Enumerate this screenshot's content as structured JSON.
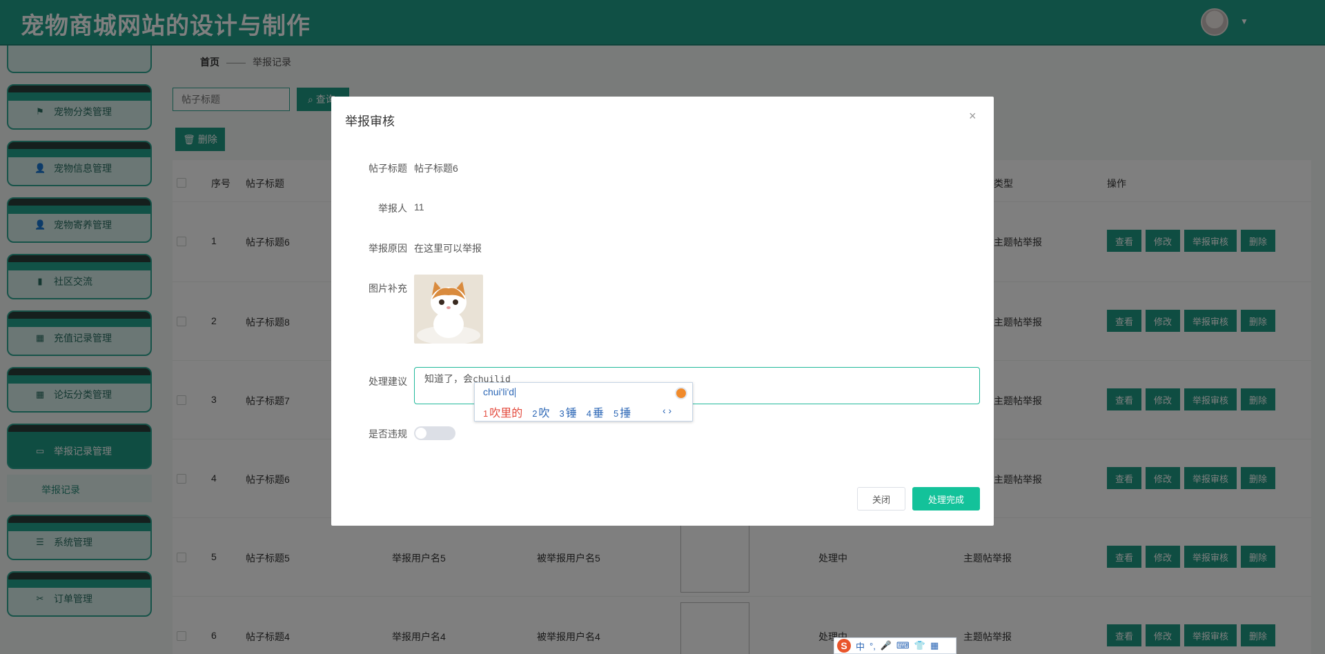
{
  "header": {
    "title": "宠物商城网站的设计与制作",
    "caret": "▼"
  },
  "sidebar": {
    "items": [
      {
        "label": "宠物分类管理",
        "icon": "⚑"
      },
      {
        "label": "宠物信息管理",
        "icon": "👤"
      },
      {
        "label": "宠物寄养管理",
        "icon": "👤"
      },
      {
        "label": "社区交流",
        "icon": "▮"
      },
      {
        "label": "充值记录管理",
        "icon": "▦"
      },
      {
        "label": "论坛分类管理",
        "icon": "▦"
      },
      {
        "label": "举报记录管理",
        "icon": "▭"
      },
      {
        "label": "系统管理",
        "icon": "☰"
      },
      {
        "label": "订单管理",
        "icon": "✂"
      }
    ],
    "submenu_label": "举报记录"
  },
  "breadcrumb": {
    "home": "首页",
    "current": "举报记录",
    "separator": "——"
  },
  "search": {
    "placeholder": "帖子标题",
    "button": "查询"
  },
  "toolbar": {
    "delete_label": "删除"
  },
  "table": {
    "headers": {
      "index": "序号",
      "title": "帖子标题",
      "type": "类型",
      "ops": "操作"
    },
    "ops": {
      "view": "查看",
      "edit": "修改",
      "review": "举报审核",
      "delete": "删除"
    },
    "rows": [
      {
        "index": "1",
        "title": "帖子标题6",
        "reporter": "",
        "reported": "",
        "status": "",
        "type": "主题帖举报"
      },
      {
        "index": "2",
        "title": "帖子标题8",
        "reporter": "",
        "reported": "",
        "status": "",
        "type": "主题帖举报"
      },
      {
        "index": "3",
        "title": "帖子标题7",
        "reporter": "",
        "reported": "",
        "status": "",
        "type": "主题帖举报"
      },
      {
        "index": "4",
        "title": "帖子标题6",
        "reporter": "",
        "reported": "",
        "status": "",
        "type": "主题帖举报"
      },
      {
        "index": "5",
        "title": "帖子标题5",
        "reporter": "举报用户名5",
        "reported": "被举报用户名5",
        "status": "处理中",
        "type": "主题帖举报"
      },
      {
        "index": "6",
        "title": "帖子标题4",
        "reporter": "举报用户名4",
        "reported": "被举报用户名4",
        "status": "处理中",
        "type": "主题帖举报"
      }
    ]
  },
  "dialog": {
    "title": "举报审核",
    "close_icon": "×",
    "fields": {
      "post_title_label": "帖子标题",
      "post_title_value": "帖子标题6",
      "reporter_label": "举报人",
      "reporter_value": "11",
      "reason_label": "举报原因",
      "reason_value": "在这里可以举报",
      "image_label": "图片补充",
      "suggestion_label": "处理建议",
      "suggestion_text": "知道了，会",
      "suggestion_composing": "chuilid",
      "violation_label": "是否违规",
      "violation_on": false
    },
    "buttons": {
      "close": "关闭",
      "done": "处理完成"
    }
  },
  "ime": {
    "pinyin": "chui'li'd",
    "candidates": [
      {
        "num": "1",
        "text": "吹里的"
      },
      {
        "num": "2",
        "text": "吹"
      },
      {
        "num": "3",
        "text": "锤"
      },
      {
        "num": "4",
        "text": "垂"
      },
      {
        "num": "5",
        "text": "捶"
      }
    ],
    "nav": "‹ ›",
    "bar": {
      "logo": "S",
      "mode": "中",
      "punct": "°,",
      "mic": "🎤",
      "keyboard": "⌨",
      "skin": "👕",
      "tools": "▦"
    }
  }
}
